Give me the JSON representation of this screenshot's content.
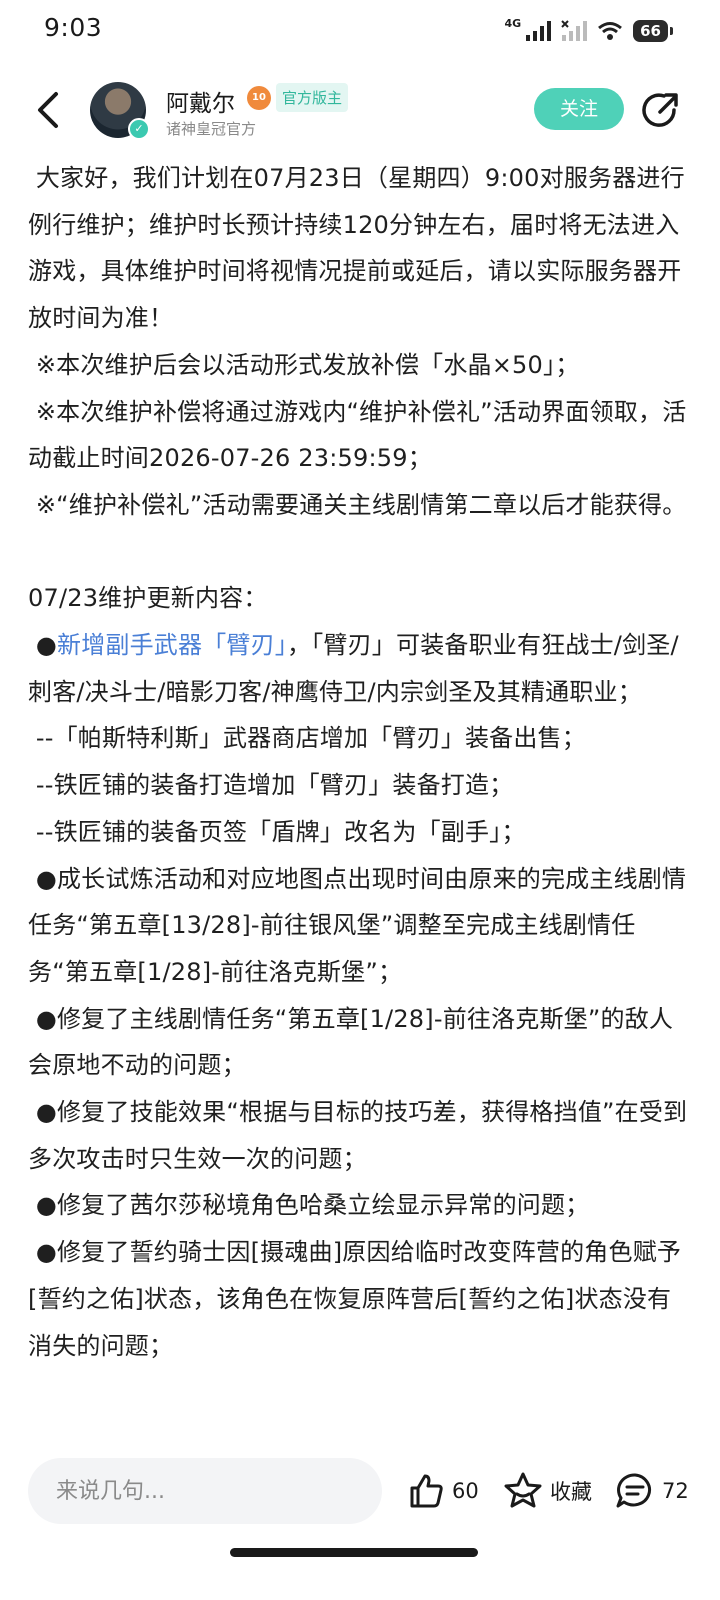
{
  "status_bar": {
    "time": "9:03",
    "network": "4G",
    "battery": "66"
  },
  "header": {
    "author_name": "阿戴尔",
    "level": "10",
    "role_tag": "官方版主",
    "author_sub": "诸神皇冠官方",
    "follow_label": "关注"
  },
  "content": {
    "p1": " 大家好，我们计划在07月23日（星期四）9:00对服务器进行例行维护；维护时长预计持续120分钟左右，届时将无法进入游戏，具体维护时间将视情况提前或延后，请以实际服务器开放时间为准！",
    "p2": " ※本次维护后会以活动形式发放补偿「水晶×50」；",
    "p3": " ※本次维护补偿将通过游戏内“维护补偿礼”活动界面领取，活动截止时间2026-07-26 23:59:59；",
    "p4": " ※“维护补偿礼”活动需要通关主线剧情第二章以后才能获得。",
    "p5": "07/23维护更新内容：",
    "p6_bullet": " ●",
    "p6_link": "新增副手武器「臂刃」",
    "p6_rest": "，「臂刃」可装备职业有狂战士/剑圣/刺客/决斗士/暗影刀客/神鹰侍卫/内宗剑圣及其精通职业；",
    "p7": " --「帕斯特利斯」武器商店增加「臂刃」装备出售；",
    "p8": " --铁匠铺的装备打造增加「臂刃」装备打造；",
    "p9": " --铁匠铺的装备页签「盾牌」改名为「副手」；",
    "p10": " ●成长试炼活动和对应地图点出现时间由原来的完成主线剧情任务“第五章[13/28]-前往银风堡”调整至完成主线剧情任务“第五章[1/28]-前往洛克斯堡”；",
    "p11": " ●修复了主线剧情任务“第五章[1/28]-前往洛克斯堡”的敌人会原地不动的问题；",
    "p12": " ●修复了技能效果“根据与目标的技巧差，获得格挡值”在受到多次攻击时只生效一次的问题；",
    "p13": " ●修复了茜尔莎秘境角色哈桑立绘显示异常的问题；",
    "p14": " ●修复了誓约骑士因[摄魂曲]原因给临时改变阵营的角色赋予[誓约之佑]状态，该角色在恢复原阵营后[誓约之佑]状态没有消失的问题；"
  },
  "bottom_bar": {
    "comment_placeholder": "来说几句...",
    "like_count": "60",
    "favorite_label": "收藏",
    "comment_count": "72"
  },
  "icons": {
    "back": "back-arrow-icon",
    "share": "share-icon",
    "like": "thumbs-up-icon",
    "favorite": "star-icon",
    "comment": "comment-bubble-icon"
  },
  "colors": {
    "accent": "#4fd1b8",
    "link": "#4a7fd6",
    "tag_text": "#32b79c"
  }
}
